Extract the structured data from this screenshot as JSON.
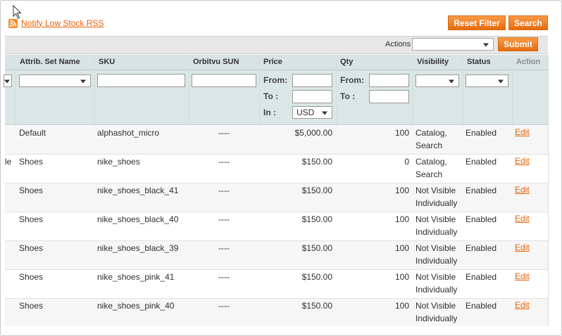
{
  "rss": {
    "label": "Notify Low Stock RSS"
  },
  "buttons": {
    "reset_filter": "Reset Filter",
    "search": "Search",
    "submit": "Submit"
  },
  "actions": {
    "label": "Actions",
    "selected": ""
  },
  "columns": [
    "Attrib. Set Name",
    "SKU",
    "Orbitvu SUN",
    "Price",
    "Qty",
    "Visibility",
    "Status",
    "Action"
  ],
  "filters": {
    "from_label": "From:",
    "to_label": "To :",
    "in_label": "In :",
    "currency": "USD"
  },
  "rows": [
    {
      "left_text": "",
      "set": "Default",
      "sku": "alphashot_micro",
      "orbitvu": "----",
      "price": "$5,000.00",
      "qty": "100",
      "vis1": "Catalog,",
      "vis2": "Search",
      "status": "Enabled",
      "action": "Edit"
    },
    {
      "left_text": "le",
      "set": "Shoes",
      "sku": "nike_shoes",
      "orbitvu": "----",
      "price": "$150.00",
      "qty": "0",
      "vis1": "Catalog,",
      "vis2": "Search",
      "status": "Enabled",
      "action": "Edit"
    },
    {
      "left_text": "",
      "set": "Shoes",
      "sku": "nike_shoes_black_41",
      "orbitvu": "----",
      "price": "$150.00",
      "qty": "100",
      "vis1": "Not Visible",
      "vis2": "Individually",
      "status": "Enabled",
      "action": "Edit"
    },
    {
      "left_text": "",
      "set": "Shoes",
      "sku": "nike_shoes_black_40",
      "orbitvu": "----",
      "price": "$150.00",
      "qty": "100",
      "vis1": "Not Visible",
      "vis2": "Individually",
      "status": "Enabled",
      "action": "Edit"
    },
    {
      "left_text": "",
      "set": "Shoes",
      "sku": "nike_shoes_black_39",
      "orbitvu": "----",
      "price": "$150.00",
      "qty": "100",
      "vis1": "Not Visible",
      "vis2": "Individually",
      "status": "Enabled",
      "action": "Edit"
    },
    {
      "left_text": "",
      "set": "Shoes",
      "sku": "nike_shoes_pink_41",
      "orbitvu": "----",
      "price": "$150.00",
      "qty": "100",
      "vis1": "Not Visible",
      "vis2": "Individually",
      "status": "Enabled",
      "action": "Edit"
    },
    {
      "left_text": "",
      "set": "Shoes",
      "sku": "nike_shoes_pink_40",
      "orbitvu": "----",
      "price": "$150.00",
      "qty": "100",
      "vis1": "Not Visible",
      "vis2": "Individually",
      "status": "Enabled",
      "action": "Edit"
    }
  ],
  "colors": {
    "accent": "#f47a20",
    "link": "#eb5e00",
    "header_bg": "#d9e3e3",
    "highlight": "#f7f77a"
  }
}
